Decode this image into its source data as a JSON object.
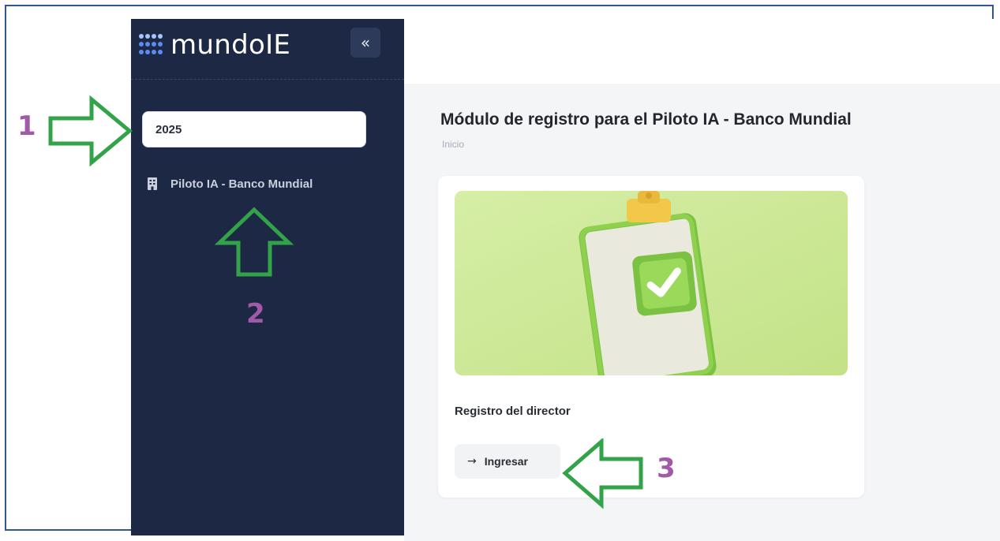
{
  "app": {
    "logo_text": "mundoIE",
    "collapse_label": "«"
  },
  "sidebar": {
    "year_value": "2025",
    "items": [
      {
        "label": "Piloto IA - Banco Mundial",
        "icon": "building-icon"
      }
    ]
  },
  "main": {
    "title": "Módulo de registro para el Piloto IA - Banco Mundial",
    "breadcrumb": "Inicio",
    "card": {
      "title": "Registro del director",
      "button_label": "Ingresar",
      "button_icon": "arrow-right-icon",
      "illustration": "clipboard-check-illustration"
    }
  },
  "annotations": {
    "step1": "1",
    "step2": "2",
    "step3": "3",
    "arrow_color": "#33a34a",
    "number_color": "#a05aa8"
  },
  "colors": {
    "sidebar_bg": "#1d2845",
    "accent_green": "#8fd14f"
  }
}
